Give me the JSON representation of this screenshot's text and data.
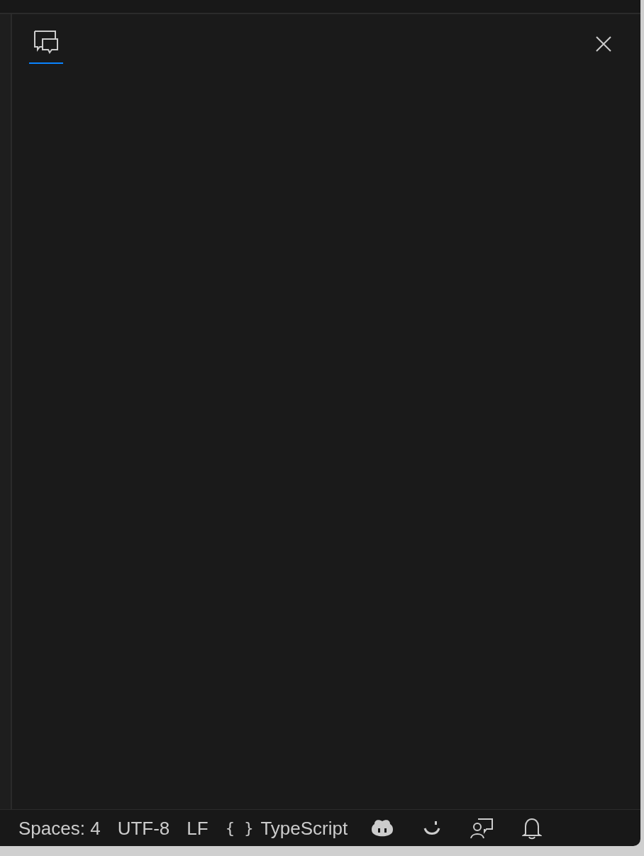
{
  "panel": {
    "tabs": [
      {
        "kind": "chat",
        "selected": true
      }
    ]
  },
  "status_bar": {
    "items": [
      {
        "kind": "text",
        "label": "Spaces: 4"
      },
      {
        "kind": "text",
        "label": "UTF-8"
      },
      {
        "kind": "text",
        "label": "LF"
      },
      {
        "kind": "language",
        "icon": "{ }",
        "label": "TypeScript"
      },
      {
        "kind": "copilot"
      },
      {
        "kind": "feedback"
      },
      {
        "kind": "accounts"
      },
      {
        "kind": "bell"
      }
    ]
  }
}
